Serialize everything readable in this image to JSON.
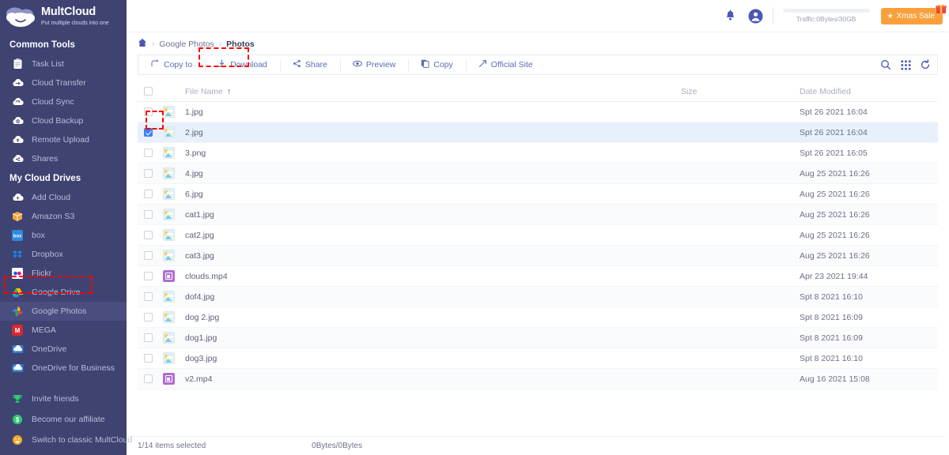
{
  "brand": {
    "name": "MultCloud",
    "tagline": "Put multiple clouds into one",
    "logo_icon": "cloud-logo-icon"
  },
  "sidebar": {
    "bg_color": "#3f4372",
    "sections": [
      {
        "title": "Common Tools",
        "items": [
          {
            "label": "Task List",
            "icon": "clipboard-icon"
          },
          {
            "label": "Cloud Transfer",
            "icon": "cloud-transfer-icon"
          },
          {
            "label": "Cloud Sync",
            "icon": "cloud-sync-icon"
          },
          {
            "label": "Cloud Backup",
            "icon": "cloud-backup-icon"
          },
          {
            "label": "Remote Upload",
            "icon": "cloud-upload-icon"
          },
          {
            "label": "Shares",
            "icon": "cloud-share-icon"
          }
        ]
      },
      {
        "title": "My Cloud Drives",
        "items": [
          {
            "label": "Add Cloud",
            "icon": "add-cloud-icon",
            "active": false
          },
          {
            "label": "Amazon S3",
            "icon": "amazon-s3-icon",
            "active": false
          },
          {
            "label": "box",
            "icon": "box-icon",
            "active": false
          },
          {
            "label": "Dropbox",
            "icon": "dropbox-icon",
            "active": false
          },
          {
            "label": "Flickr",
            "icon": "flickr-icon",
            "active": false
          },
          {
            "label": "Google Drive",
            "icon": "google-drive-icon",
            "active": false
          },
          {
            "label": "Google Photos",
            "icon": "google-photos-icon",
            "active": true
          },
          {
            "label": "MEGA",
            "icon": "mega-icon",
            "active": false
          },
          {
            "label": "OneDrive",
            "icon": "onedrive-icon",
            "active": false
          },
          {
            "label": "OneDrive for Business",
            "icon": "onedrive-business-icon",
            "active": false
          }
        ]
      }
    ],
    "bottom_items": [
      {
        "label": "Invite friends",
        "icon": "trophy-icon"
      },
      {
        "label": "Become our affiliate",
        "icon": "dollar-icon"
      },
      {
        "label": "Switch to classic MultCloud",
        "icon": "smiley-icon"
      }
    ]
  },
  "topbar": {
    "bell_icon": "notification-bell-icon",
    "avatar_icon": "user-avatar-icon",
    "traffic_text": "Traffic:0Bytes/30GB",
    "traffic_percent": 0,
    "promo_label": "Xmas Sale",
    "promo_star_icon": "star-icon",
    "promo_gift_icon": "gift-icon",
    "promo_color": "#f9a03c"
  },
  "breadcrumb": {
    "home_icon": "home-icon",
    "separator": "›",
    "items": [
      {
        "label": "Google Photos",
        "current": false
      },
      {
        "label": "Photos",
        "current": true
      }
    ]
  },
  "toolbar": {
    "items": [
      {
        "label": "Copy to",
        "icon": "copy-to-icon",
        "highlighted": false
      },
      {
        "label": "Download",
        "icon": "download-icon",
        "highlighted": true
      },
      {
        "label": "Share",
        "icon": "share-icon",
        "highlighted": false
      },
      {
        "label": "Preview",
        "icon": "eye-icon",
        "highlighted": false
      },
      {
        "label": "Copy",
        "icon": "copy-icon",
        "highlighted": false
      },
      {
        "label": "Official Site",
        "icon": "external-link-icon",
        "highlighted": false
      }
    ],
    "right_icons": [
      {
        "name": "search-icon"
      },
      {
        "name": "grid-view-icon"
      },
      {
        "name": "refresh-icon"
      }
    ]
  },
  "table": {
    "columns": [
      {
        "label": "File Name",
        "sort": "↑"
      },
      {
        "label": "Size"
      },
      {
        "label": "Date Modified"
      }
    ],
    "header_checkbox_checked": false,
    "rows": [
      {
        "name": "1.jpg",
        "type": "image",
        "size": "",
        "date": "Spt 26 2021 16:04",
        "checked": false
      },
      {
        "name": "2.jpg",
        "type": "image",
        "size": "",
        "date": "Spt 26 2021 16:04",
        "checked": true
      },
      {
        "name": "3.png",
        "type": "image",
        "size": "",
        "date": "Spt 26 2021 16:05",
        "checked": false
      },
      {
        "name": "4.jpg",
        "type": "image",
        "size": "",
        "date": "Aug 25 2021 16:26",
        "checked": false
      },
      {
        "name": "6.jpg",
        "type": "image",
        "size": "",
        "date": "Aug 25 2021 16:26",
        "checked": false
      },
      {
        "name": "cat1.jpg",
        "type": "image",
        "size": "",
        "date": "Aug 25 2021 16:26",
        "checked": false
      },
      {
        "name": "cat2.jpg",
        "type": "image",
        "size": "",
        "date": "Aug 25 2021 16:26",
        "checked": false
      },
      {
        "name": "cat3.jpg",
        "type": "image",
        "size": "",
        "date": "Aug 25 2021 16:26",
        "checked": false
      },
      {
        "name": "clouds.mp4",
        "type": "video",
        "size": "",
        "date": "Apr 23 2021 19:44",
        "checked": false
      },
      {
        "name": "dof4.jpg",
        "type": "image",
        "size": "",
        "date": "Spt 8 2021 16:10",
        "checked": false
      },
      {
        "name": "dog 2.jpg",
        "type": "image",
        "size": "",
        "date": "Spt 8 2021 16:09",
        "checked": false
      },
      {
        "name": "dog1.jpg",
        "type": "image",
        "size": "",
        "date": "Spt 8 2021 16:09",
        "checked": false
      },
      {
        "name": "dog3.jpg",
        "type": "image",
        "size": "",
        "date": "Spt 8 2021 16:10",
        "checked": false
      },
      {
        "name": "v2.mp4",
        "type": "video",
        "size": "",
        "date": "Aug 16 2021 15:08",
        "checked": false
      }
    ]
  },
  "statusbar": {
    "selected_text": "1/14 items selected",
    "size_text": "0Bytes/0Bytes"
  },
  "annotations": {
    "color": "#ff0000",
    "boxes": [
      {
        "name": "download-button-highlight"
      },
      {
        "name": "row-checkbox-highlight"
      },
      {
        "name": "google-photos-sidebar-highlight"
      }
    ]
  }
}
